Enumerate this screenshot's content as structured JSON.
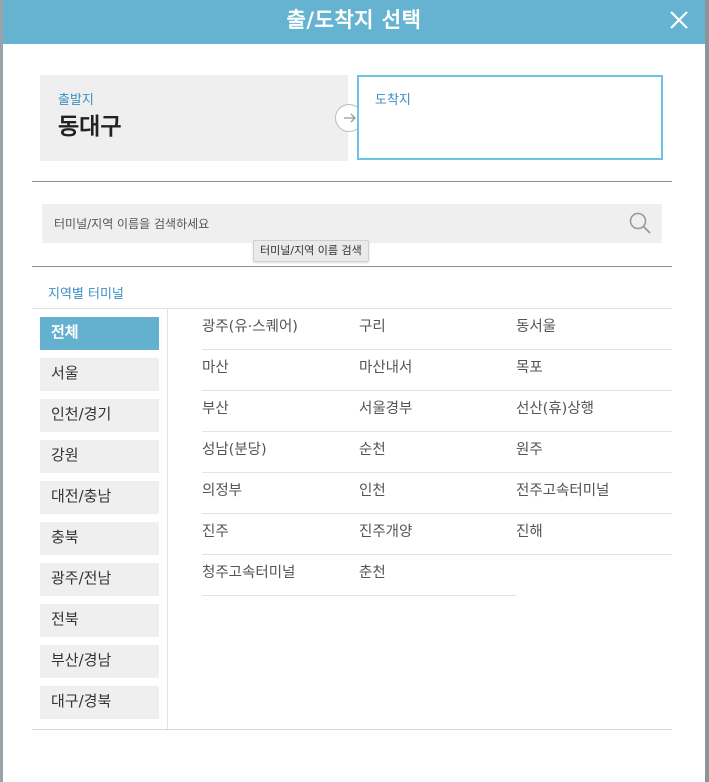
{
  "dialog": {
    "title": "출/도착지 선택"
  },
  "departure": {
    "label": "출발지",
    "value": "동대구"
  },
  "arrival": {
    "label": "도착지",
    "value": ""
  },
  "search": {
    "placeholder": "터미널/지역 이름을 검색하세요",
    "tooltip": "터미널/지역 이름 검색"
  },
  "section": {
    "title": "지역별 터미널"
  },
  "regions": [
    "전체",
    "서울",
    "인천/경기",
    "강원",
    "대전/충남",
    "충북",
    "광주/전남",
    "전북",
    "부산/경남",
    "대구/경북"
  ],
  "active_region": "전체",
  "terminals": [
    [
      "광주(유·스퀘어)",
      "구리",
      "동서울"
    ],
    [
      "마산",
      "마산내서",
      "목포"
    ],
    [
      "부산",
      "서울경부",
      "선산(휴)상행"
    ],
    [
      "성남(분당)",
      "순천",
      "원주"
    ],
    [
      "의정부",
      "인천",
      "전주고속터미널"
    ],
    [
      "진주",
      "진주개양",
      "진해"
    ],
    [
      "청주고속터미널",
      "춘천"
    ]
  ],
  "colors": {
    "header": "#65b3d0",
    "accent": "#3b8fc5",
    "active_region": "#63b1cf",
    "arrival_border": "#6cc3e6"
  },
  "icons": {
    "close": "close-icon",
    "search": "search-icon",
    "arrow": "arrow-right-icon"
  }
}
